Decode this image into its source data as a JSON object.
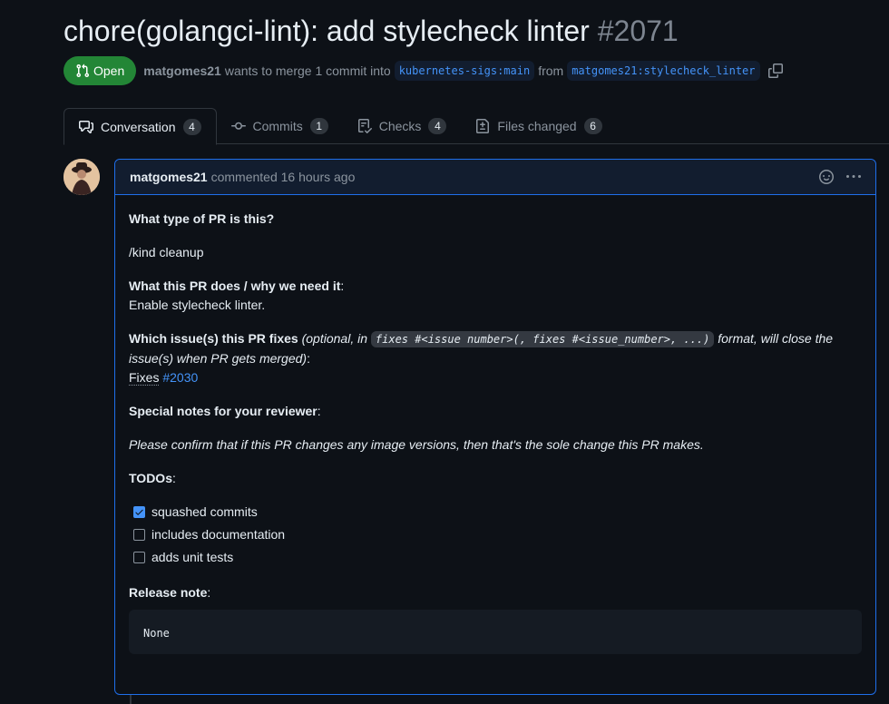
{
  "pr": {
    "title": "chore(golangci-lint): add stylecheck linter",
    "number": "#2071",
    "state": "Open",
    "author": "matgomes21",
    "merge_text": "wants to merge 1 commit into",
    "base_branch": "kubernetes-sigs:main",
    "from_text": "from",
    "head_branch": "matgomes21:stylecheck_linter"
  },
  "tabs": [
    {
      "label": "Conversation",
      "count": "4",
      "icon": "comment-discussion-icon"
    },
    {
      "label": "Commits",
      "count": "1",
      "icon": "git-commit-icon"
    },
    {
      "label": "Checks",
      "count": "4",
      "icon": "checklist-icon"
    },
    {
      "label": "Files changed",
      "count": "6",
      "icon": "file-diff-icon"
    }
  ],
  "comment": {
    "author": "matgomes21",
    "action": "commented 16 hours ago",
    "q1": "What type of PR is this?",
    "kind": "/kind cleanup",
    "q2": "What this PR does / why we need it",
    "colon": ":",
    "answer2": "Enable stylecheck linter.",
    "q3": "Which issue(s) this PR fixes",
    "q3_note_pre": "(optional, in",
    "q3_code": "fixes #<issue number>(, fixes #<issue_number>, ...)",
    "q3_note_post": "format, will close the issue(s) when PR gets merged)",
    "fixes_label": "Fixes",
    "fixes_link": "#2030",
    "q4": "Special notes for your reviewer",
    "note": "Please confirm that if this PR changes any image versions, then that's the sole change this PR makes.",
    "todos": "TODOs",
    "tasks": [
      {
        "label": "squashed commits",
        "checked": true
      },
      {
        "label": "includes documentation",
        "checked": false
      },
      {
        "label": "adds unit tests",
        "checked": false
      }
    ],
    "release_note": "Release note",
    "release_value": "None"
  },
  "colors": {
    "background": "#0d1117",
    "open_badge": "#238636",
    "link": "#4493f8",
    "comment_border": "#1f6feb"
  }
}
